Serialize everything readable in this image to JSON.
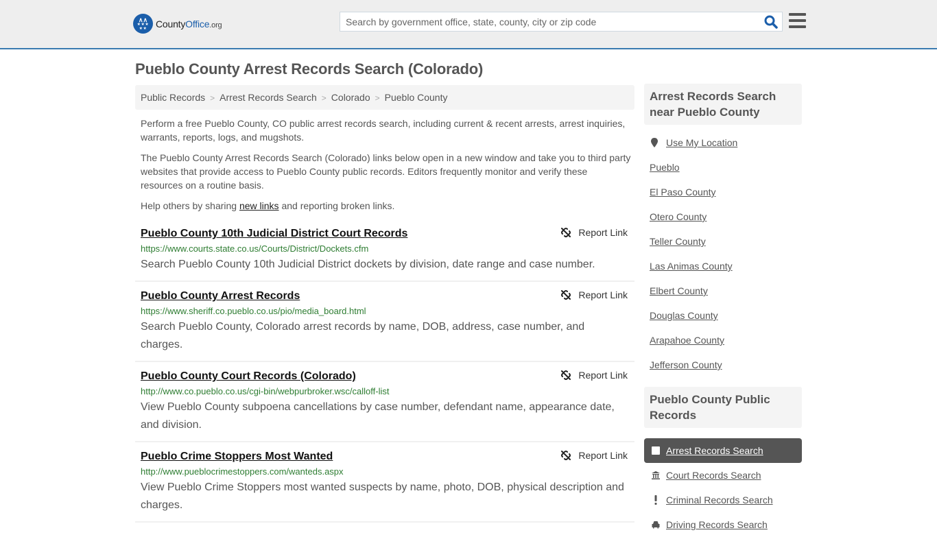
{
  "header": {
    "logo": {
      "county": "County",
      "office": "Office",
      "org": ".org"
    },
    "search": {
      "placeholder": "Search by government office, state, county, city or zip code",
      "value": ""
    },
    "colors": {
      "brand": "#1b5eaa",
      "accent_border": "#3a7bb0"
    }
  },
  "page": {
    "title": "Pueblo County Arrest Records Search (Colorado)"
  },
  "breadcrumb": [
    {
      "label": "Public Records"
    },
    {
      "label": "Arrest Records Search"
    },
    {
      "label": "Colorado"
    },
    {
      "label": "Pueblo County"
    }
  ],
  "breadcrumb_separator": ">",
  "intro": {
    "p1": "Perform a free Pueblo County, CO public arrest records search, including current & recent arrests, arrest inquiries, warrants, reports, logs, and mugshots.",
    "p2": "The Pueblo County Arrest Records Search (Colorado) links below open in a new window and take you to third party websites that provide access to Pueblo County public records. Editors frequently monitor and verify these resources on a routine basis.",
    "p3_before": "Help others by sharing ",
    "p3_link": "new links",
    "p3_after": " and reporting broken links."
  },
  "results": [
    {
      "title": "Pueblo County 10th Judicial District Court Records",
      "url": "https://www.courts.state.co.us/Courts/District/Dockets.cfm",
      "description": "Search Pueblo County 10th Judicial District dockets by division, date range and case number.",
      "report_label": "Report Link"
    },
    {
      "title": "Pueblo County Arrest Records",
      "url": "https://www.sheriff.co.pueblo.co.us/pio/media_board.html",
      "description": "Search Pueblo County, Colorado arrest records by name, DOB, address, case number, and charges.",
      "report_label": "Report Link"
    },
    {
      "title": "Pueblo County Court Records (Colorado)",
      "url": "http://www.co.pueblo.co.us/cgi-bin/webpurbroker.wsc/calloff-list",
      "description": "View Pueblo County subpoena cancellations by case number, defendant name, appearance date, and division.",
      "report_label": "Report Link"
    },
    {
      "title": "Pueblo Crime Stoppers Most Wanted",
      "url": "http://www.pueblocrimestoppers.com/wanteds.aspx",
      "description": "View Pueblo Crime Stoppers most wanted suspects by name, photo, DOB, physical description and charges.",
      "report_label": "Report Link"
    }
  ],
  "sidebar": {
    "nearby_heading": "Arrest Records Search near Pueblo County",
    "use_location": "Use My Location",
    "nearby": [
      "Pueblo",
      "El Paso County",
      "Otero County",
      "Teller County",
      "Las Animas County",
      "Elbert County",
      "Douglas County",
      "Arapahoe County",
      "Jefferson County"
    ],
    "public_records_heading": "Pueblo County Public Records",
    "public_records": [
      {
        "label": "Arrest Records Search",
        "icon": "square-icon",
        "active": true
      },
      {
        "label": "Court Records Search",
        "icon": "courthouse-icon",
        "active": false
      },
      {
        "label": "Criminal Records Search",
        "icon": "exclamation-icon",
        "active": false
      },
      {
        "label": "Driving Records Search",
        "icon": "car-icon",
        "active": false
      }
    ]
  }
}
